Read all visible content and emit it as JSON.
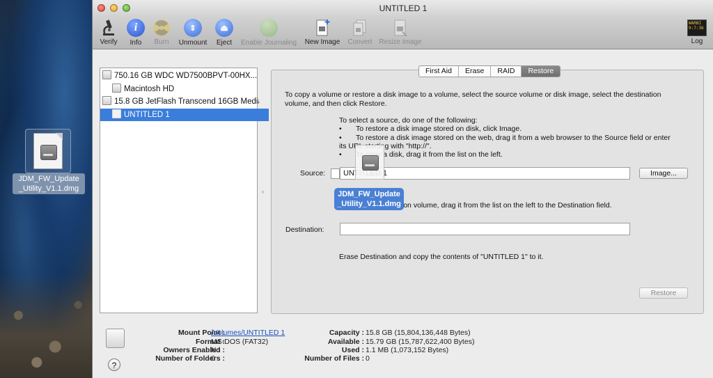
{
  "desktop": {
    "file_label": "JDM_FW_Update\n_Utility_V1.1.dmg"
  },
  "window": {
    "title": "UNTITLED 1"
  },
  "toolbar": {
    "verify": "Verify",
    "info": "Info",
    "burn": "Burn",
    "unmount": "Unmount",
    "eject": "Eject",
    "enable_journaling": "Enable Journaling",
    "new_image": "New Image",
    "convert": "Convert",
    "resize_image": "Resize Image",
    "log": "Log",
    "log_icon_text": "WARNI\n9:7:36"
  },
  "sidebar": {
    "items": [
      {
        "label": "750.16 GB WDC WD7500BPVT-00HX..."
      },
      {
        "label": "Macintosh HD"
      },
      {
        "label": "15.8 GB JetFlash Transcend 16GB Media"
      },
      {
        "label": "UNTITLED 1"
      }
    ]
  },
  "tabs": [
    "First Aid",
    "Erase",
    "RAID",
    "Restore"
  ],
  "restore": {
    "intro": "To copy a volume or restore a disk image to a volume, select the source volume or disk image, select the destination volume, and then click Restore.",
    "source_heading": "To select a source, do one of the following:",
    "bullet1": "To restore a disk image stored on disk, click Image.",
    "bullet2a": "To restore a disk image stored on the web, drag it from a web browser to the Source field or enter",
    "bullet2b": "its URL starting with \"http://\".",
    "bullet3": "To copy a disk, drag it from the list on the left.",
    "bullet_char": "•",
    "source_label": "Source:",
    "source_value": "UNTITLED 1",
    "image_button": "Image...",
    "dest_hint": "To select a destination volume, drag it from the list on the left to the Destination field.",
    "dest_label": "Destination:",
    "dest_value": "",
    "erase_text": "Erase Destination and copy the contents of \"UNTITLED 1\" to it.",
    "restore_button": "Restore"
  },
  "drag": {
    "label": "JDM_FW_Update\n_Utility_V1.1.dmg"
  },
  "info": {
    "mount_point_k": "Mount Point :",
    "mount_point_v": "/Volumes/UNTITLED 1",
    "format_k": "Format :",
    "format_v": "MS-DOS (FAT32)",
    "owners_k": "Owners Enabled :",
    "owners_v": "No",
    "folders_k": "Number of Folders :",
    "folders_v": "0",
    "capacity_k": "Capacity :",
    "capacity_v": "15.8 GB (15,804,136,448 Bytes)",
    "available_k": "Available :",
    "available_v": "15.79 GB (15,787,622,400 Bytes)",
    "used_k": "Used :",
    "used_v": "1.1 MB (1,073,152 Bytes)",
    "files_k": "Number of Files :",
    "files_v": "0",
    "help": "?"
  }
}
